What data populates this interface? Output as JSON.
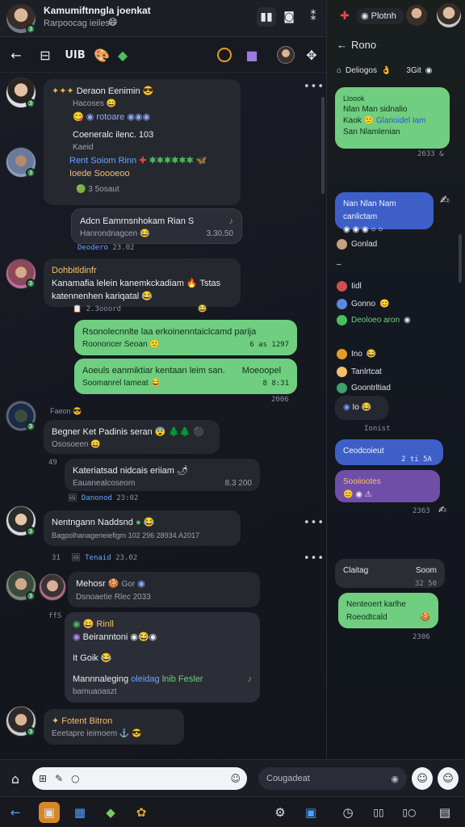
{
  "status_bar": {
    "title": "Kamumiftnngla joenkat",
    "subtitle": "Rarpoocag ieiles"
  },
  "toolbar": {
    "label": "UIB"
  },
  "messages": [
    {
      "title": "Deraon Eenimin",
      "line1": "Hacoses",
      "line2": "Coeneralc ilenc. 103",
      "line3": "Kaeid",
      "link": "Rent Soiom Rinn",
      "line4": "Ioede Soooeoo",
      "meta": "3 5osaut"
    },
    {
      "reply_title": "Adcn Eamrnsnhokam Rian S",
      "reply_sub": "Hanrondnagcen",
      "reply_link": "Deodero",
      "reply_time1": "23.02",
      "reply_time2": "3.30.50"
    },
    {
      "name": "Dohbitldinfr",
      "line1": "Kanamafia lelein kanemkckadiam",
      "line1b": "Tstas",
      "line2": "katennenhen kariqatal",
      "meta": "2.3ooord"
    },
    {
      "green1": "Rsonolecnnlte laa erkoinenntaiclcamd parija",
      "green1_sub": "Roononcer Seoan",
      "green1_time": "6 as 1297",
      "green2": "Aoeuls eanmiktiar kentaan leim san.",
      "green2_b": "Moeoopel",
      "green2_sub": "Soomanrel Iameat",
      "green2_time": "8 8:31",
      "green2_time2": "2006"
    },
    {
      "label": "Faeon",
      "title": "Begner Ket Padinis seran",
      "sub": "Ososoeen"
    },
    {
      "text": "Kateriatsad nidcais eriiam",
      "sub": "Eauanealcoseom",
      "link": "Danonod",
      "time1": "23:02",
      "time2": "8.3 200"
    },
    {
      "title": "Nentngann Naddsnd",
      "sub": "Bagpolhanageneiefigm 102 296 28934.A2017",
      "meta": "31",
      "link": "Tenaid",
      "time": "23.02"
    },
    {
      "title": "Mehosr",
      "sub1": "Gor",
      "sub2": "Dsnoaetie Rlec 2033",
      "meta": "ffS",
      "r1": "Rinll",
      "r2": "Beiranntoni",
      "r3": "It Goik",
      "r4": "Mannnaleging",
      "r4b": "oleidag",
      "r4c": "lnib Fesler",
      "r5": "bamuaoaszt"
    },
    {
      "title": "Fotent Bitron",
      "sub": "Eeetapre ieimoem"
    }
  ],
  "right_panel": {
    "header": "Plotnh",
    "back_label": "Rono",
    "sub": "Deliogos",
    "sub_meta": "3Git",
    "green1_title": "Lloook",
    "green1_line1": "Nlan Man sidnalio",
    "green1_line2a": "Kaok",
    "green1_line2b": "Glanoidel Iam",
    "green1_line3": "San Nlamlenian",
    "green1_time": "2633 &",
    "blue1": "Nan Nlan Nam canlictam",
    "list": [
      {
        "label": "Gonlad"
      },
      {
        "label": "Iidl"
      },
      {
        "label": "Gonno"
      },
      {
        "label": "Deoloeo aron"
      },
      {
        "label": "Ino"
      },
      {
        "label": "Tanlrtcat"
      },
      {
        "label": "Goontrltiad"
      },
      {
        "label": "Io"
      }
    ],
    "time1": "Ionist",
    "blue2": "Ceodcoieut",
    "blue2_time": "2 ti 5A",
    "purple": "Sooiiootes",
    "purple_time": "2363",
    "gray_title": "Claitag",
    "gray_right": "Soom",
    "gray_time": "32 50",
    "green2_line1": "Nenteoert karlhe",
    "green2_line2": "Roeodtcald",
    "green2_time": "2306"
  },
  "composer": {
    "placeholder": "Cougadeat"
  },
  "colors": {
    "accent_green": "#6fce7f",
    "accent_blue": "#3e5fc8",
    "accent_purple": "#6f4ea8",
    "background": "#141720"
  }
}
